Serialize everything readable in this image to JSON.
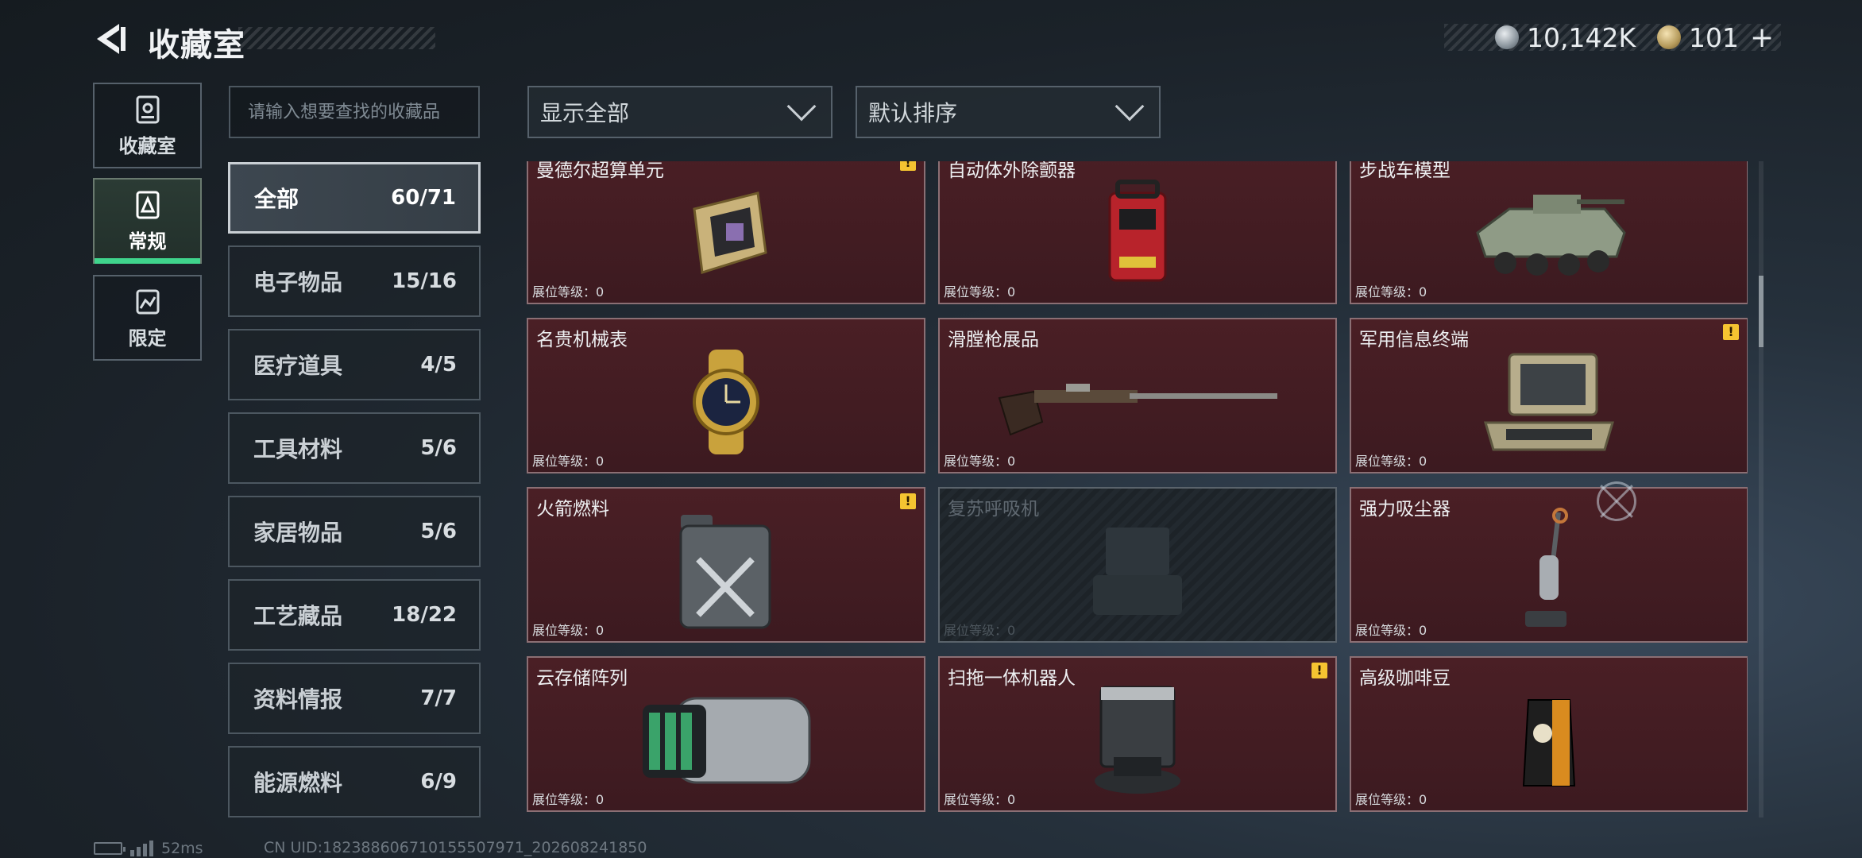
{
  "header": {
    "title": "收藏室",
    "currency_1_value": "10,142K",
    "currency_2_value": "101",
    "plus_label": "+"
  },
  "rail": {
    "items": [
      {
        "label": "收藏室",
        "icon": "collection-room-icon",
        "active": false
      },
      {
        "label": "常规",
        "icon": "regular-icon",
        "active": true
      },
      {
        "label": "限定",
        "icon": "limited-icon",
        "active": false
      }
    ]
  },
  "search": {
    "placeholder": "请输入想要查找的收藏品"
  },
  "categories": [
    {
      "name": "全部",
      "count": "60/71",
      "active": true
    },
    {
      "name": "电子物品",
      "count": "15/16"
    },
    {
      "name": "医疗道具",
      "count": "4/5"
    },
    {
      "name": "工具材料",
      "count": "5/6"
    },
    {
      "name": "家居物品",
      "count": "5/6"
    },
    {
      "name": "工艺藏品",
      "count": "18/22"
    },
    {
      "name": "资料情报",
      "count": "7/7"
    },
    {
      "name": "能源燃料",
      "count": "6/9"
    }
  ],
  "filters": {
    "display": "显示全部",
    "sort": "默认排序"
  },
  "level_label": "展位等级：0",
  "items": [
    {
      "name": "曼德尔超算单元",
      "alert": true,
      "locked": false
    },
    {
      "name": "自动体外除颤器",
      "alert": false,
      "locked": false
    },
    {
      "name": "步战车模型",
      "alert": false,
      "locked": false
    },
    {
      "name": "名贵机械表",
      "alert": false,
      "locked": false
    },
    {
      "name": "滑膛枪展品",
      "alert": false,
      "locked": false
    },
    {
      "name": "军用信息终端",
      "alert": true,
      "locked": false
    },
    {
      "name": "火箭燃料",
      "alert": true,
      "locked": false
    },
    {
      "name": "复苏呼吸机",
      "alert": false,
      "locked": true
    },
    {
      "name": "强力吸尘器",
      "alert": false,
      "locked": false
    },
    {
      "name": "云存储阵列",
      "alert": false,
      "locked": false
    },
    {
      "name": "扫拖一体机器人",
      "alert": true,
      "locked": false
    },
    {
      "name": "高级咖啡豆",
      "alert": false,
      "locked": false
    }
  ],
  "alert_mark": "!",
  "footer": {
    "ping": "52ms",
    "uid": "CN UID:182388606710155507971_202608241850"
  }
}
